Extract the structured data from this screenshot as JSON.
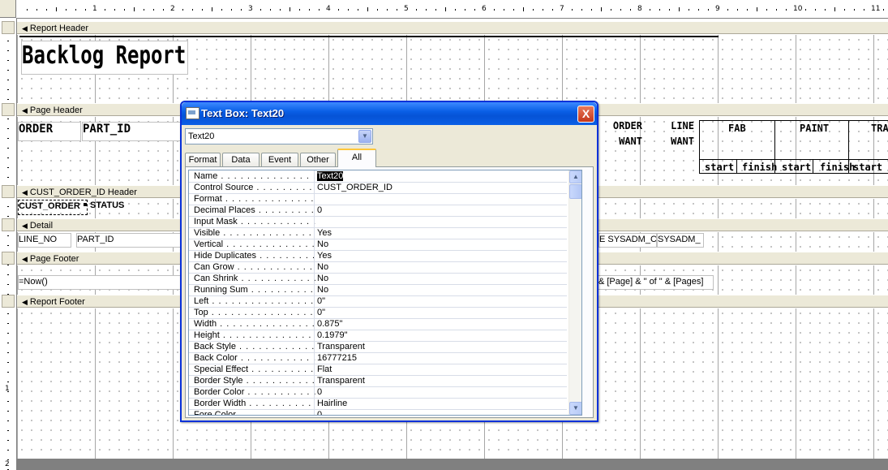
{
  "ruler": {
    "h_numbers": [
      "1",
      "2",
      "3",
      "4",
      "5",
      "6",
      "7",
      "8",
      "9",
      "10",
      "11"
    ],
    "v_numbers": [
      "1",
      "2"
    ]
  },
  "sections": {
    "report_header": "Report Header",
    "page_header": "Page Header",
    "cust_order_header": "CUST_ORDER_ID Header",
    "detail": "Detail",
    "page_footer": "Page Footer",
    "report_footer": "Report Footer"
  },
  "report": {
    "title": "Backlog Report",
    "page_header": {
      "order": "ORDER",
      "part_id": "PART_ID",
      "order_want_1": "ORDER",
      "order_want_2": "WANT",
      "line_want_1": "LINE",
      "line_want_2": "WANT",
      "fab": "FAB",
      "paint": "PAINT",
      "trac": "TRAC",
      "start1": "start",
      "finish1": "finish",
      "start2": "start",
      "finish2": "finish",
      "start3": "start"
    },
    "cust_header": {
      "cust_order": "CUST_ORDER",
      "status": "STATUS"
    },
    "detail": {
      "line_no": "LINE_NO",
      "part_id": "PART_ID",
      "sysadm1": "E SYSADM_C",
      "sysadm2": "SYSADM_"
    },
    "page_footer": {
      "now": "=Now()",
      "page_expr": "\" & [Page] & \" of \" & [Pages]"
    }
  },
  "dialog": {
    "title": "Text Box: Text20",
    "close": "X",
    "combo_value": "Text20",
    "tabs": [
      "Format",
      "Data",
      "Event",
      "Other",
      "All"
    ],
    "active_tab": "All",
    "properties": [
      {
        "name": "Name",
        "value": "Text20"
      },
      {
        "name": "Control Source",
        "value": "CUST_ORDER_ID"
      },
      {
        "name": "Format",
        "value": ""
      },
      {
        "name": "Decimal Places",
        "value": "0"
      },
      {
        "name": "Input Mask",
        "value": ""
      },
      {
        "name": "Visible",
        "value": "Yes"
      },
      {
        "name": "Vertical",
        "value": "No"
      },
      {
        "name": "Hide Duplicates",
        "value": "Yes"
      },
      {
        "name": "Can Grow",
        "value": "No"
      },
      {
        "name": "Can Shrink",
        "value": "No"
      },
      {
        "name": "Running Sum",
        "value": "No"
      },
      {
        "name": "Left",
        "value": "0\""
      },
      {
        "name": "Top",
        "value": "0\""
      },
      {
        "name": "Width",
        "value": "0.875\""
      },
      {
        "name": "Height",
        "value": "0.1979\""
      },
      {
        "name": "Back Style",
        "value": "Transparent"
      },
      {
        "name": "Back Color",
        "value": "16777215"
      },
      {
        "name": "Special Effect",
        "value": "Flat"
      },
      {
        "name": "Border Style",
        "value": "Transparent"
      },
      {
        "name": "Border Color",
        "value": "0"
      },
      {
        "name": "Border Width",
        "value": "Hairline"
      },
      {
        "name": "Fore Color",
        "value": "0"
      }
    ]
  },
  "colors": {
    "title_bar": "#0a5fe6",
    "section_bar": "#ece9d8",
    "dialog_bg": "#ece9d8"
  }
}
